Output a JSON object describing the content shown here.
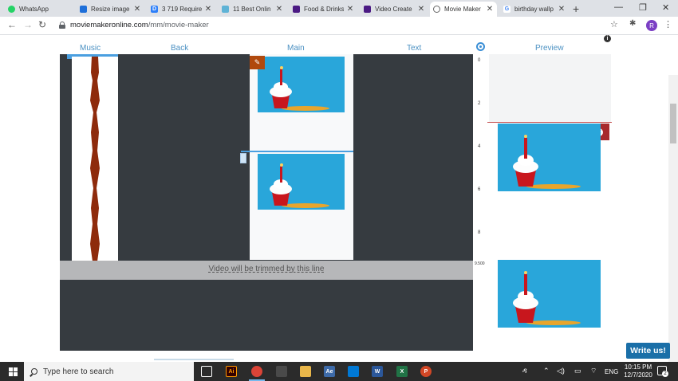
{
  "browser": {
    "tabs": [
      {
        "title": "WhatsApp",
        "icon": "whatsapp-icon",
        "color": "#25d366"
      },
      {
        "title": "Resize image f",
        "icon": "resize-icon",
        "color": "#1e6fd9"
      },
      {
        "title": "3 719 Require",
        "icon": "d-icon",
        "color": "#2d7ff9"
      },
      {
        "title": "11 Best Onlin",
        "icon": "tool-icon",
        "color": "#5fb3d6"
      },
      {
        "title": "Food & Drinks",
        "icon": "canva-icon",
        "color": "#4b1a83"
      },
      {
        "title": "Video Create",
        "icon": "canva-icon",
        "color": "#4b1a83"
      },
      {
        "title": "Movie Maker",
        "icon": "moviemaker-icon",
        "color": "#555555"
      },
      {
        "title": "birthday wallp",
        "icon": "google-icon",
        "color": "#4285f4"
      }
    ],
    "active_tab_index": 6,
    "new_tab_label": "+",
    "url_domain": "moviemakeronline.com",
    "url_path": "/mm/movie-maker",
    "profile_initial": "R"
  },
  "editor": {
    "columns": {
      "music": "Music",
      "back": "Back",
      "main": "Main",
      "text": "Text",
      "preview": "Preview"
    },
    "trim_label": "Video will be trimmed by this line",
    "ruler_ticks": [
      "0",
      "2",
      "4",
      "6",
      "8"
    ],
    "ruler_end": "9.500",
    "info_label": "i",
    "pin_label": "✎",
    "delete_label": "✕",
    "write_button": "Write us!",
    "accent_color": "#4a90c2"
  },
  "taskbar": {
    "search_placeholder": "Type here to search",
    "language": "ENG",
    "time": "10:15 PM",
    "date": "12/7/2020",
    "notification_count": "2"
  }
}
